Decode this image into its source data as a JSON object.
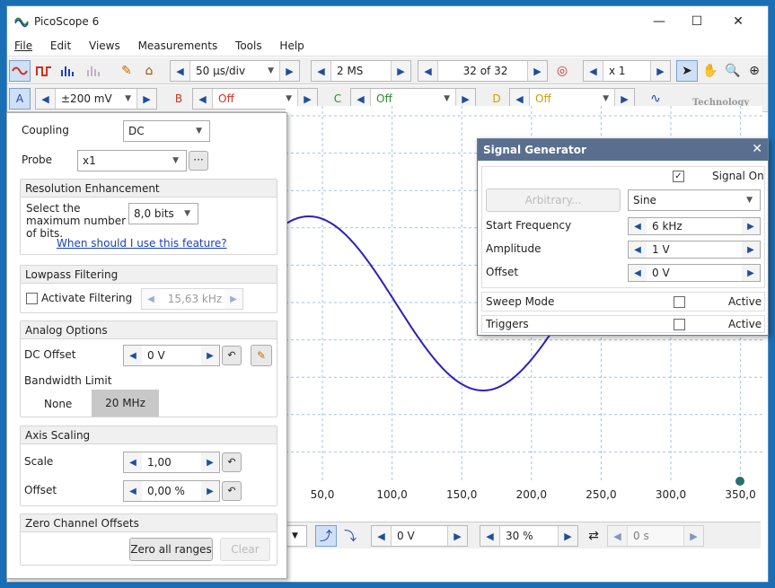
{
  "window": {
    "title": "PicoScope 6",
    "minimize": "—",
    "maximize": "☐",
    "close": "✕"
  },
  "menu": [
    "File",
    "Edit",
    "Views",
    "Measurements",
    "Tools",
    "Help"
  ],
  "toolbar": {
    "timebase": "50 µs/div",
    "samples": "2 MS",
    "buffer": "32 of 32",
    "zoom": "x 1",
    "logo_text": "Technology"
  },
  "channel_bar": {
    "a": {
      "letter": "A",
      "range": "±200 mV",
      "color": "#1f3fbf"
    },
    "b": {
      "letter": "B",
      "range": "Off",
      "color": "#d03020"
    },
    "c": {
      "letter": "C",
      "range": "Off",
      "color": "#2a8a2a"
    },
    "d": {
      "letter": "D",
      "range": "Off",
      "color": "#c8a000"
    }
  },
  "panel": {
    "coupling_label": "Coupling",
    "coupling": "DC",
    "probe_label": "Probe",
    "probe": "x1",
    "probe_more": "···",
    "res_header": "Resolution Enhancement",
    "res_text": "Select the maximum number of bits.",
    "res_value": "8,0 bits",
    "res_link": "When should I use this feature?",
    "lp_header": "Lowpass Filtering",
    "lp_activate": "Activate Filtering",
    "lp_value": "15,63 kHz",
    "ao_header": "Analog Options",
    "dc_offset_label": "DC Offset",
    "dc_offset": "0 V",
    "bw_label": "Bandwidth Limit",
    "bw_none": "None",
    "bw_20": "20 MHz",
    "axis_header": "Axis Scaling",
    "scale_label": "Scale",
    "scale": "1,00",
    "offset_label": "Offset",
    "offset": "0,00 %",
    "zero_header": "Zero Channel Offsets",
    "zero_all": "Zero all ranges",
    "clear": "Clear"
  },
  "scope": {
    "x_ticks": [
      "50,0",
      "100,0",
      "150,0",
      "200,0",
      "250,0",
      "300,0",
      "350,0"
    ],
    "trace_color": "#2b1fc0"
  },
  "bottom": {
    "trigger_level": "0 V",
    "pretrigger": "30 %",
    "delay": "0 s"
  },
  "siggen": {
    "title": "Signal Generator",
    "signal_on": "Signal On",
    "arbitrary": "Arbitrary...",
    "wave": "Sine",
    "start_freq_label": "Start Frequency",
    "start_freq": "6 kHz",
    "amp_label": "Amplitude",
    "amp": "1 V",
    "offset_label": "Offset",
    "offset": "0 V",
    "sweep_label": "Sweep Mode",
    "sweep_active": "Active",
    "triggers_label": "Triggers",
    "triggers_active": "Active"
  }
}
